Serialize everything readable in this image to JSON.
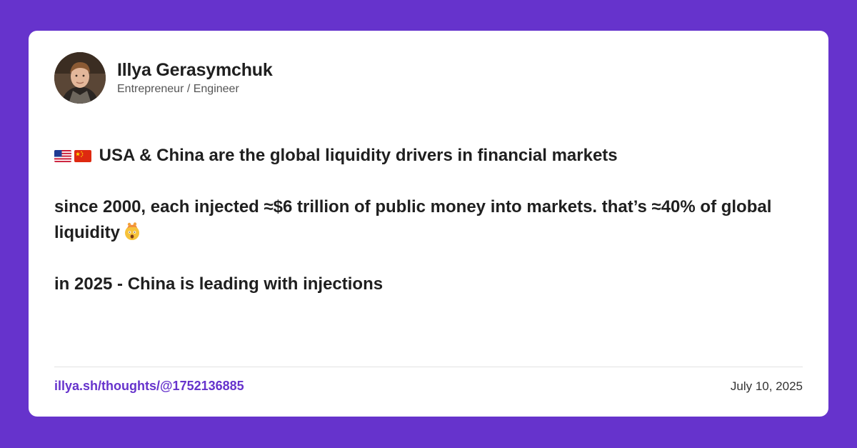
{
  "author": {
    "name": "Illya Gerasymchuk",
    "role": "Entrepreneur / Engineer"
  },
  "post": {
    "line1_text": "USA & China are the global liquidity drivers in financial markets",
    "line2_text": "since 2000, each injected ≈$6 trillion of public money into markets. that’s ≈40% of global liquidity",
    "line3_text": "in 2025 - China is leading with injections",
    "icons": [
      "us-flag-icon",
      "china-flag-icon",
      "mind-blown-emoji-icon"
    ]
  },
  "footer": {
    "link": "illya.sh/thoughts/@1752136885",
    "date": "July 10, 2025"
  },
  "colors": {
    "background": "#6633cc",
    "card": "#ffffff",
    "link": "#6633cc",
    "text": "#1f1f1f"
  }
}
